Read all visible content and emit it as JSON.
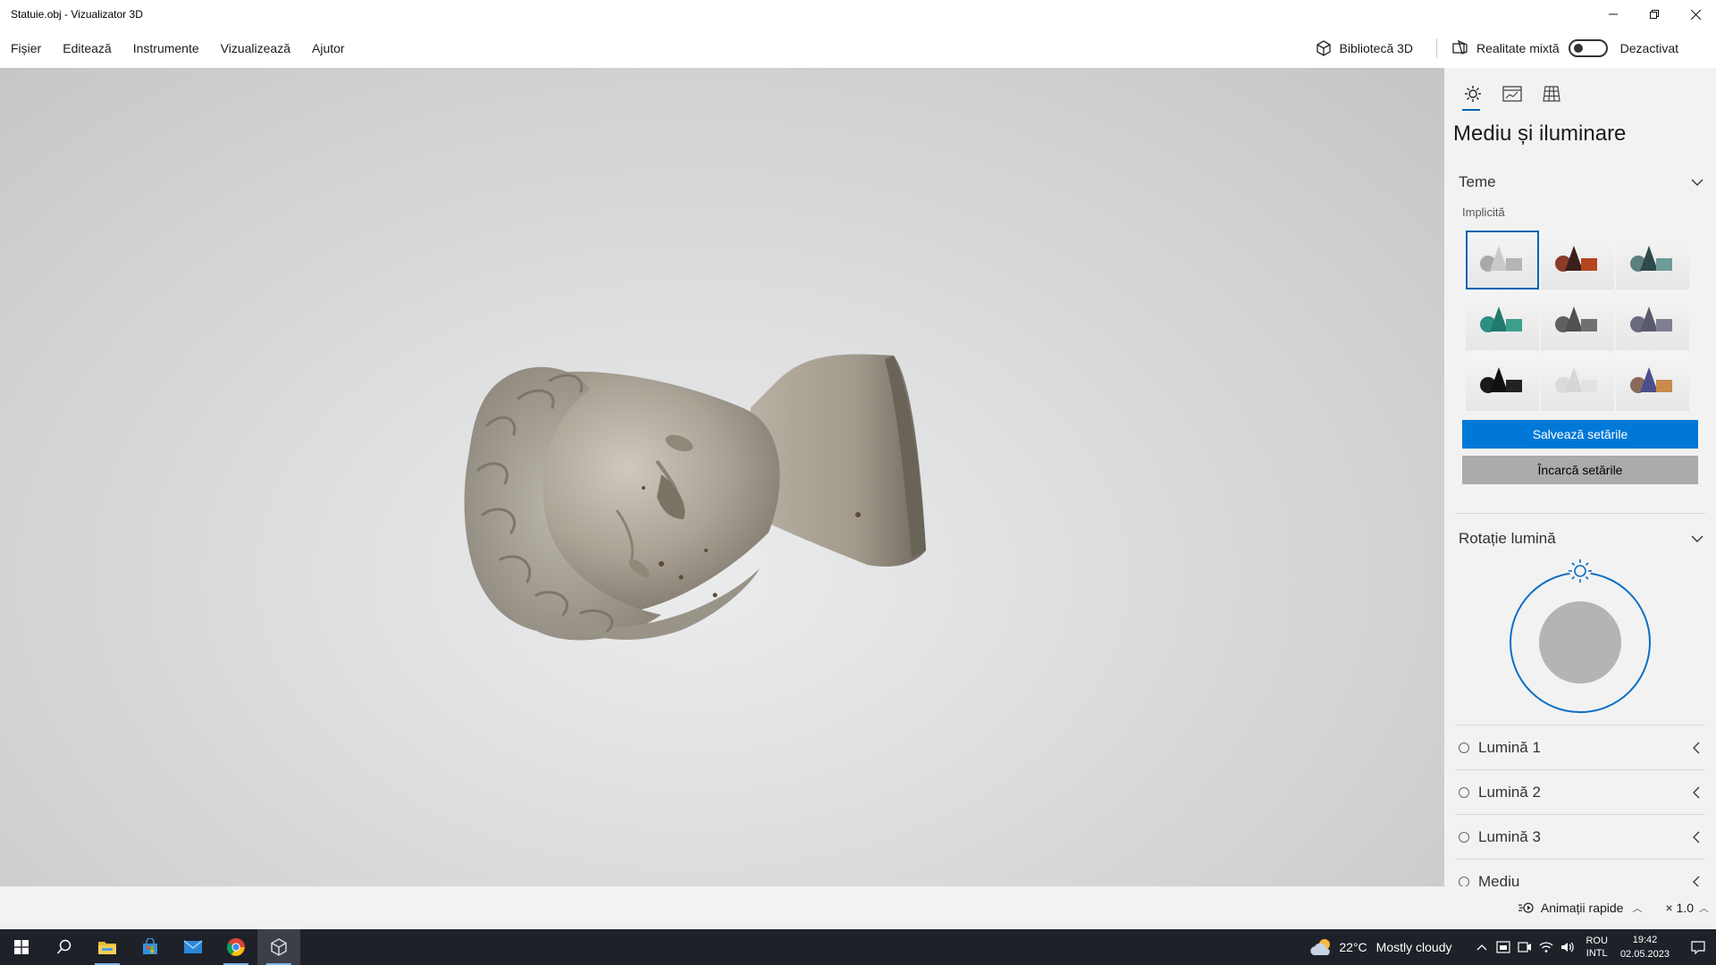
{
  "window": {
    "title": "Statuie.obj - Vizualizator 3D",
    "controls": {
      "minimize": "—",
      "restore": "❐",
      "close": "✕"
    }
  },
  "menu": {
    "items": [
      "Fișier",
      "Editează",
      "Instrumente",
      "Vizualizează",
      "Ajutor"
    ],
    "library_label": "Bibliotecă 3D",
    "mixed_reality_label": "Realitate mixtă",
    "mixed_reality_state": "Dezactivat",
    "mixed_reality_on": false
  },
  "viewport": {
    "object": "statue-bust-model"
  },
  "panel": {
    "tabs": [
      "environment-lighting-tab",
      "stats-shading-tab",
      "grid-views-tab"
    ],
    "title": "Mediu și iluminare",
    "themes_section": {
      "heading": "Teme",
      "group_label": "Implicită",
      "themes": [
        {
          "id": "theme-1",
          "colors": [
            "#c9c9c9",
            "#b5b5b5",
            "#a8a8a8"
          ],
          "selected": true
        },
        {
          "id": "theme-2",
          "colors": [
            "#3a1f1a",
            "#b4451f",
            "#8a3b2a"
          ],
          "selected": false
        },
        {
          "id": "theme-3",
          "colors": [
            "#2f4a4a",
            "#6f9a9a",
            "#5c8080"
          ],
          "selected": false
        },
        {
          "id": "theme-4",
          "colors": [
            "#1e7a6b",
            "#3aa08d",
            "#2d8f7f"
          ],
          "selected": false
        },
        {
          "id": "theme-5",
          "colors": [
            "#505050",
            "#707070",
            "#606060"
          ],
          "selected": false
        },
        {
          "id": "theme-6",
          "colors": [
            "#5a5a6a",
            "#7f7f92",
            "#6a6a80"
          ],
          "selected": false
        },
        {
          "id": "theme-7",
          "colors": [
            "#101010",
            "#222222",
            "#1a1a1a"
          ],
          "selected": false
        },
        {
          "id": "theme-8",
          "colors": [
            "#d6d6d6",
            "#e2e2e2",
            "#dadada"
          ],
          "selected": false
        },
        {
          "id": "theme-9",
          "colors": [
            "#4c4f8a",
            "#c98a4a",
            "#8a6a5a"
          ],
          "selected": false
        }
      ],
      "save_label": "Salvează setările",
      "load_label": "Încarcă setările"
    },
    "rotation_section": {
      "heading": "Rotație lumină"
    },
    "lights": [
      {
        "label": "Lumină 1"
      },
      {
        "label": "Lumină 2"
      },
      {
        "label": "Lumină 3"
      },
      {
        "label": "Mediu"
      }
    ]
  },
  "statusbar": {
    "animations_label": "Animații rapide",
    "speed_label": "× 1.0"
  },
  "taskbar": {
    "apps": [
      "start-icon",
      "search-icon",
      "file-explorer-icon",
      "store-icon",
      "mail-icon",
      "chrome-icon",
      "3d-viewer-icon"
    ],
    "weather": {
      "temperature": "22°C",
      "condition": "Mostly cloudy"
    },
    "language": {
      "line1": "ROU",
      "line2": "INTL"
    },
    "time": "19:42",
    "date": "02.05.2023"
  },
  "colors": {
    "accent": "#0078d7",
    "taskbar": "#1f2129",
    "panel": "#f2f2f2"
  }
}
